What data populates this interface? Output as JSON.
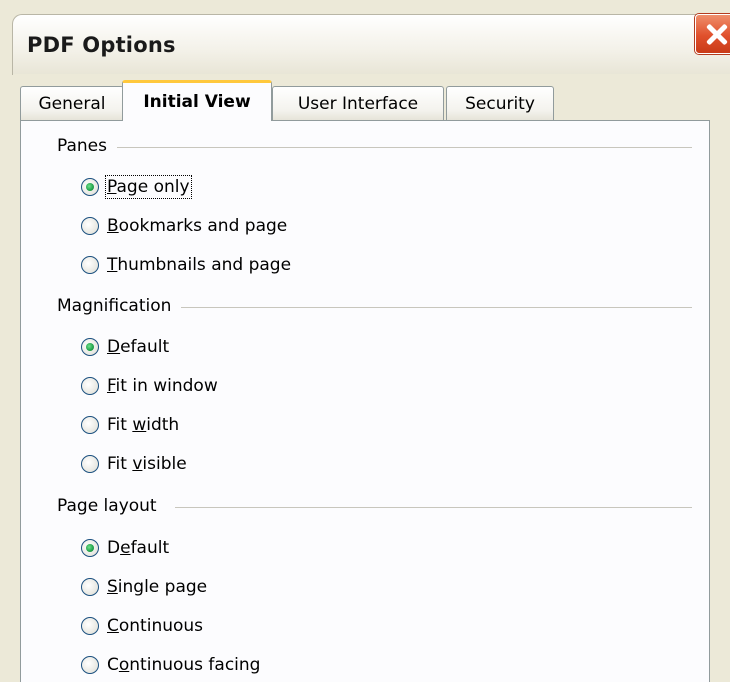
{
  "window": {
    "title": "PDF Options"
  },
  "tabs": [
    {
      "label": "General",
      "active": false
    },
    {
      "label": "Initial View",
      "active": true
    },
    {
      "label": "User Interface",
      "active": false
    },
    {
      "label": "Security",
      "active": false
    }
  ],
  "groups": {
    "panes": {
      "label": "Panes",
      "options": [
        {
          "pre": "",
          "key": "P",
          "post": "age only",
          "checked": true
        },
        {
          "pre": "",
          "key": "B",
          "post": "ookmarks and page",
          "checked": false
        },
        {
          "pre": "",
          "key": "T",
          "post": "humbnails and page",
          "checked": false
        }
      ]
    },
    "magnification": {
      "label": "Magnification",
      "options": [
        {
          "pre": "",
          "key": "D",
          "post": "efault",
          "checked": true
        },
        {
          "pre": "",
          "key": "F",
          "post": "it in window",
          "checked": false
        },
        {
          "pre": "Fit ",
          "key": "w",
          "post": "idth",
          "checked": false
        },
        {
          "pre": "Fit ",
          "key": "v",
          "post": "isible",
          "checked": false
        }
      ]
    },
    "page_layout": {
      "label": "Page layout",
      "options": [
        {
          "pre": "D",
          "key": "e",
          "post": "fault",
          "checked": true
        },
        {
          "pre": "",
          "key": "S",
          "post": "ingle page",
          "checked": false
        },
        {
          "pre": "",
          "key": "C",
          "post": "ontinuous",
          "checked": false
        },
        {
          "pre": "C",
          "key": "o",
          "post": "ntinuous facing",
          "checked": false
        }
      ]
    }
  },
  "colors": {
    "active_tab_accent": "#ffc83c",
    "radio_checked_dot": "#21a14b",
    "close_button": "#e0502c"
  },
  "icons": {
    "close": "close-icon"
  }
}
